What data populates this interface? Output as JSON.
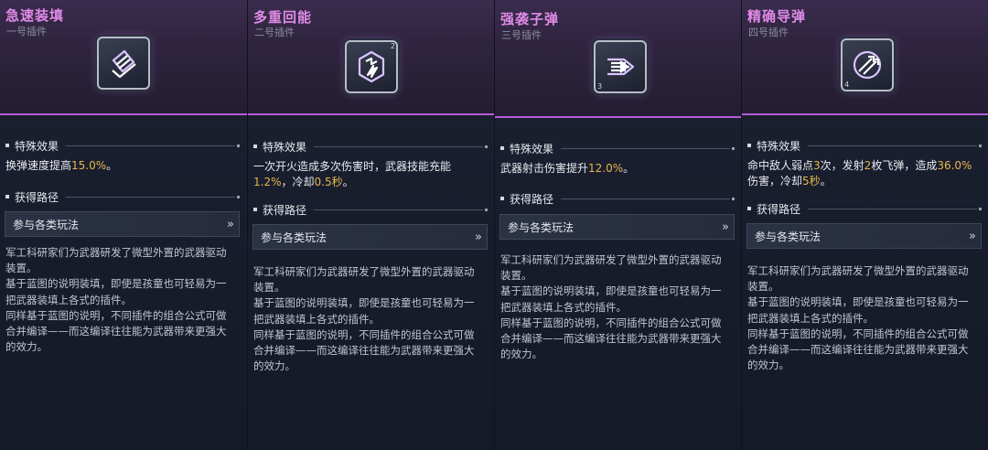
{
  "panels": [
    {
      "title": "急速装填",
      "subtitle": "一号插件",
      "icon": "magazine-reload-icon",
      "icon_corner": "",
      "effect_header": "特殊效果",
      "effect_parts": [
        "换弹速度提高",
        "15.0%",
        "。"
      ],
      "route_header": "获得路径",
      "route_label": "参与各类玩法",
      "desc_lines": [
        "军工科研家们为武器研发了微型外置的武器驱动",
        "装置。",
        "基于蓝图的说明装填，即使是孩童也可轻易为一",
        "把武器装填上各式的插件。",
        "同样基于蓝图的说明，不同插件的组合公式可做",
        "合并编译——而这编译往往能为武器带来更强大",
        "的效力。"
      ]
    },
    {
      "title": "多重回能",
      "subtitle": "二号插件",
      "icon": "energy-recharge-icon",
      "icon_corner": "2",
      "effect_header": "特殊效果",
      "effect_parts": [
        "一次开火造成多次伤害时，武器技能充能",
        "1.2%",
        "，冷却",
        "0.5秒",
        "。"
      ],
      "route_header": "获得路径",
      "route_label": "参与各类玩法",
      "desc_lines": [
        "军工科研家们为武器研发了微型外置的武器驱动",
        "装置。",
        "基于蓝图的说明装填，即使是孩童也可轻易为一",
        "把武器装填上各式的插件。",
        "同样基于蓝图的说明，不同插件的组合公式可做",
        "合并编译——而这编译往往能为武器带来更强大",
        "的效力。"
      ]
    },
    {
      "title": "强袭子弹",
      "subtitle": "三号插件",
      "icon": "assault-bullet-icon",
      "icon_corner": "3",
      "effect_header": "特殊效果",
      "effect_parts": [
        "武器射击伤害提升",
        "12.0%",
        "。"
      ],
      "route_header": "获得路径",
      "route_label": "参与各类玩法",
      "desc_lines": [
        "军工科研家们为武器研发了微型外置的武器驱动",
        "装置。",
        "基于蓝图的说明装填，即使是孩童也可轻易为一",
        "把武器装填上各式的插件。",
        "同样基于蓝图的说明，不同插件的组合公式可做",
        "合并编译——而这编译往往能为武器带来更强大",
        "的效力。"
      ]
    },
    {
      "title": "精确导弹",
      "subtitle": "四号插件",
      "icon": "guided-missile-icon",
      "icon_corner": "4",
      "effect_header": "特殊效果",
      "effect_parts": [
        "命中敌人弱点",
        "3",
        "次，发射",
        "2",
        "枚飞弹，造成",
        "36.0%",
        "伤害，冷却",
        "5秒",
        "。"
      ],
      "route_header": "获得路径",
      "route_label": "参与各类玩法",
      "desc_lines": [
        "军工科研家们为武器研发了微型外置的武器驱动",
        "装置。",
        "基于蓝图的说明装填，即使是孩童也可轻易为一",
        "把武器装填上各式的插件。",
        "同样基于蓝图的说明，不同插件的组合公式可做",
        "合并编译——而这编译往往能为武器带来更强大",
        "的效力。"
      ]
    }
  ],
  "route_chevron": "»",
  "colors": {
    "title": "#e08be6",
    "highlight": "#e6b64a",
    "accent_line": "#b45cd8"
  }
}
